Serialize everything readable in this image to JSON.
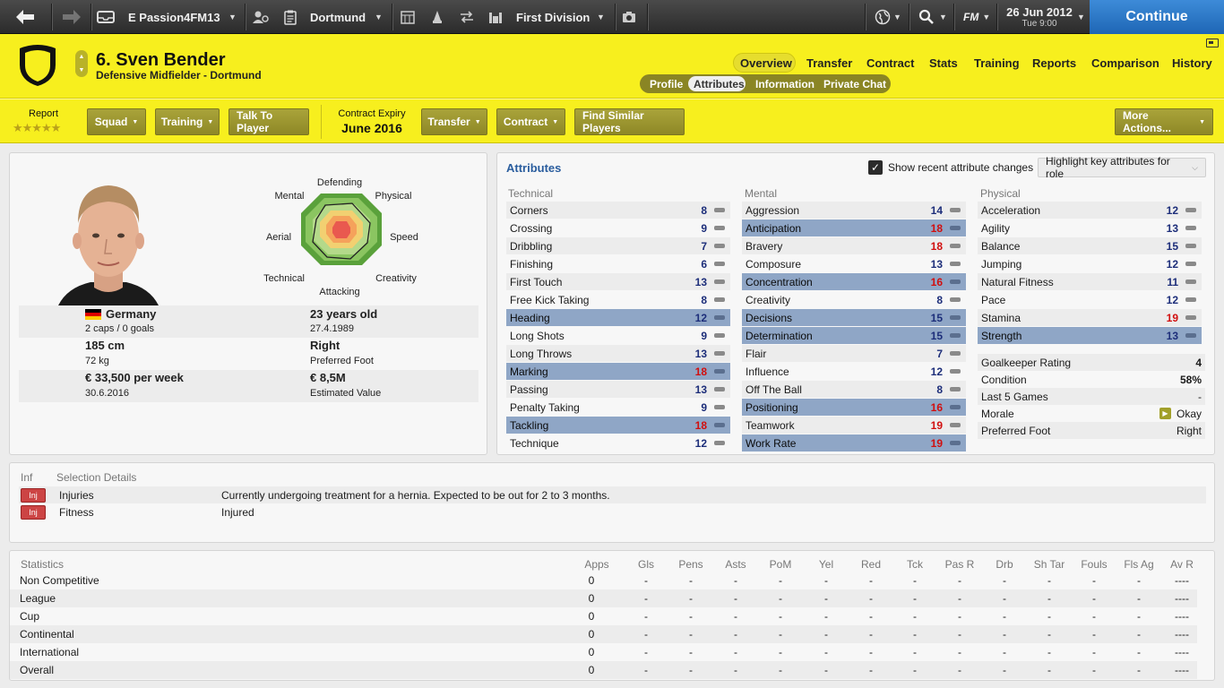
{
  "topbar": {
    "manager": "E Passion4FM13",
    "club": "Dortmund",
    "competition": "First Division",
    "fm_label": "FM",
    "date": "26 Jun 2012",
    "time": "Tue 9:00",
    "continue": "Continue"
  },
  "player": {
    "title": "6. Sven Bender",
    "subtitle": "Defensive Midfielder - Dortmund"
  },
  "tabs_top": [
    "Overview",
    "Transfer",
    "Contract",
    "Stats",
    "Training",
    "Reports",
    "Comparison",
    "History"
  ],
  "tabs_sub": [
    "Profile",
    "Attributes",
    "Information",
    "Private Chat"
  ],
  "actions": {
    "report_label": "Report",
    "stars": "★★★★★",
    "squad": "Squad",
    "training": "Training",
    "talk": "Talk To Player",
    "contract_expiry_label": "Contract Expiry",
    "contract_expiry_value": "June 2016",
    "transfer": "Transfer",
    "contract": "Contract",
    "find_similar": "Find Similar Players",
    "more_actions": "More Actions..."
  },
  "radar": {
    "labels": [
      "Defending",
      "Physical",
      "Speed",
      "Creativity",
      "Attacking",
      "Technical",
      "Aerial",
      "Mental"
    ]
  },
  "profile": {
    "nation": "Germany",
    "caps": "2 caps / 0 goals",
    "age": "23 years old",
    "dob": "27.4.1989",
    "height": "185 cm",
    "weight": "72 kg",
    "foot": "Right",
    "foot_label": "Preferred Foot",
    "wage": "€ 33,500 per week",
    "contract_end": "30.6.2016",
    "value": "€ 8,5M",
    "value_label": "Estimated Value"
  },
  "attributes_panel": {
    "title": "Attributes",
    "show_changes": "Show recent attribute changes",
    "highlight": "Highlight key attributes for role",
    "technical_head": "Technical",
    "mental_head": "Mental",
    "physical_head": "Physical",
    "technical": [
      {
        "name": "Corners",
        "value": "8"
      },
      {
        "name": "Crossing",
        "value": "9"
      },
      {
        "name": "Dribbling",
        "value": "7"
      },
      {
        "name": "Finishing",
        "value": "6"
      },
      {
        "name": "First Touch",
        "value": "13"
      },
      {
        "name": "Free Kick Taking",
        "value": "8"
      },
      {
        "name": "Heading",
        "value": "12"
      },
      {
        "name": "Long Shots",
        "value": "9"
      },
      {
        "name": "Long Throws",
        "value": "13"
      },
      {
        "name": "Marking",
        "value": "18"
      },
      {
        "name": "Passing",
        "value": "13"
      },
      {
        "name": "Penalty Taking",
        "value": "9"
      },
      {
        "name": "Tackling",
        "value": "18"
      },
      {
        "name": "Technique",
        "value": "12"
      }
    ],
    "mental": [
      {
        "name": "Aggression",
        "value": "14"
      },
      {
        "name": "Anticipation",
        "value": "18"
      },
      {
        "name": "Bravery",
        "value": "18"
      },
      {
        "name": "Composure",
        "value": "13"
      },
      {
        "name": "Concentration",
        "value": "16"
      },
      {
        "name": "Creativity",
        "value": "8"
      },
      {
        "name": "Decisions",
        "value": "15"
      },
      {
        "name": "Determination",
        "value": "15"
      },
      {
        "name": "Flair",
        "value": "7"
      },
      {
        "name": "Influence",
        "value": "12"
      },
      {
        "name": "Off The Ball",
        "value": "8"
      },
      {
        "name": "Positioning",
        "value": "16"
      },
      {
        "name": "Teamwork",
        "value": "19"
      },
      {
        "name": "Work Rate",
        "value": "19"
      }
    ],
    "physical": [
      {
        "name": "Acceleration",
        "value": "12"
      },
      {
        "name": "Agility",
        "value": "13"
      },
      {
        "name": "Balance",
        "value": "15"
      },
      {
        "name": "Jumping",
        "value": "12"
      },
      {
        "name": "Natural Fitness",
        "value": "11"
      },
      {
        "name": "Pace",
        "value": "12"
      },
      {
        "name": "Stamina",
        "value": "19"
      },
      {
        "name": "Strength",
        "value": "13"
      }
    ],
    "extra": [
      {
        "name": "Goalkeeper Rating",
        "value": "4"
      },
      {
        "name": "Condition",
        "value": "58%"
      },
      {
        "name": "Last 5 Games",
        "value": "-"
      },
      {
        "name": "Morale",
        "value": "Okay"
      },
      {
        "name": "Preferred Foot",
        "value": "Right"
      }
    ]
  },
  "selection": {
    "head_inf": "Inf",
    "head_details": "Selection Details",
    "rows": [
      {
        "badge": "Inj",
        "label": "Injuries",
        "text": "Currently undergoing treatment for a hernia. Expected to be out for 2 to 3 months."
      },
      {
        "badge": "Inj",
        "label": "Fitness",
        "text": "Injured"
      }
    ]
  },
  "statistics": {
    "title": "Statistics",
    "columns": [
      "Apps",
      "Gls",
      "Pens",
      "Asts",
      "PoM",
      "Yel",
      "Red",
      "Tck",
      "Pas R",
      "Drb",
      "Sh Tar",
      "Fouls",
      "Fls Ag",
      "Av R"
    ],
    "rows": [
      {
        "name": "Non Competitive",
        "values": [
          "0",
          "-",
          "-",
          "-",
          "-",
          "-",
          "-",
          "-",
          "-",
          "-",
          "-",
          "-",
          "-",
          "----"
        ]
      },
      {
        "name": "League",
        "values": [
          "0",
          "-",
          "-",
          "-",
          "-",
          "-",
          "-",
          "-",
          "-",
          "-",
          "-",
          "-",
          "-",
          "----"
        ]
      },
      {
        "name": "Cup",
        "values": [
          "0",
          "-",
          "-",
          "-",
          "-",
          "-",
          "-",
          "-",
          "-",
          "-",
          "-",
          "-",
          "-",
          "----"
        ]
      },
      {
        "name": "Continental",
        "values": [
          "0",
          "-",
          "-",
          "-",
          "-",
          "-",
          "-",
          "-",
          "-",
          "-",
          "-",
          "-",
          "-",
          "----"
        ]
      },
      {
        "name": "International",
        "values": [
          "0",
          "-",
          "-",
          "-",
          "-",
          "-",
          "-",
          "-",
          "-",
          "-",
          "-",
          "-",
          "-",
          "----"
        ]
      },
      {
        "name": "Overall",
        "values": [
          "0",
          "-",
          "-",
          "-",
          "-",
          "-",
          "-",
          "-",
          "-",
          "-",
          "-",
          "-",
          "-",
          "----"
        ]
      }
    ]
  },
  "colors": {
    "club_yellow": "#f7ef1e",
    "highlight_blue": "#8fa6c6",
    "value_blue": "#1d2e7a",
    "value_red": "#d10f0f",
    "continue_blue": "#2a78c8"
  }
}
